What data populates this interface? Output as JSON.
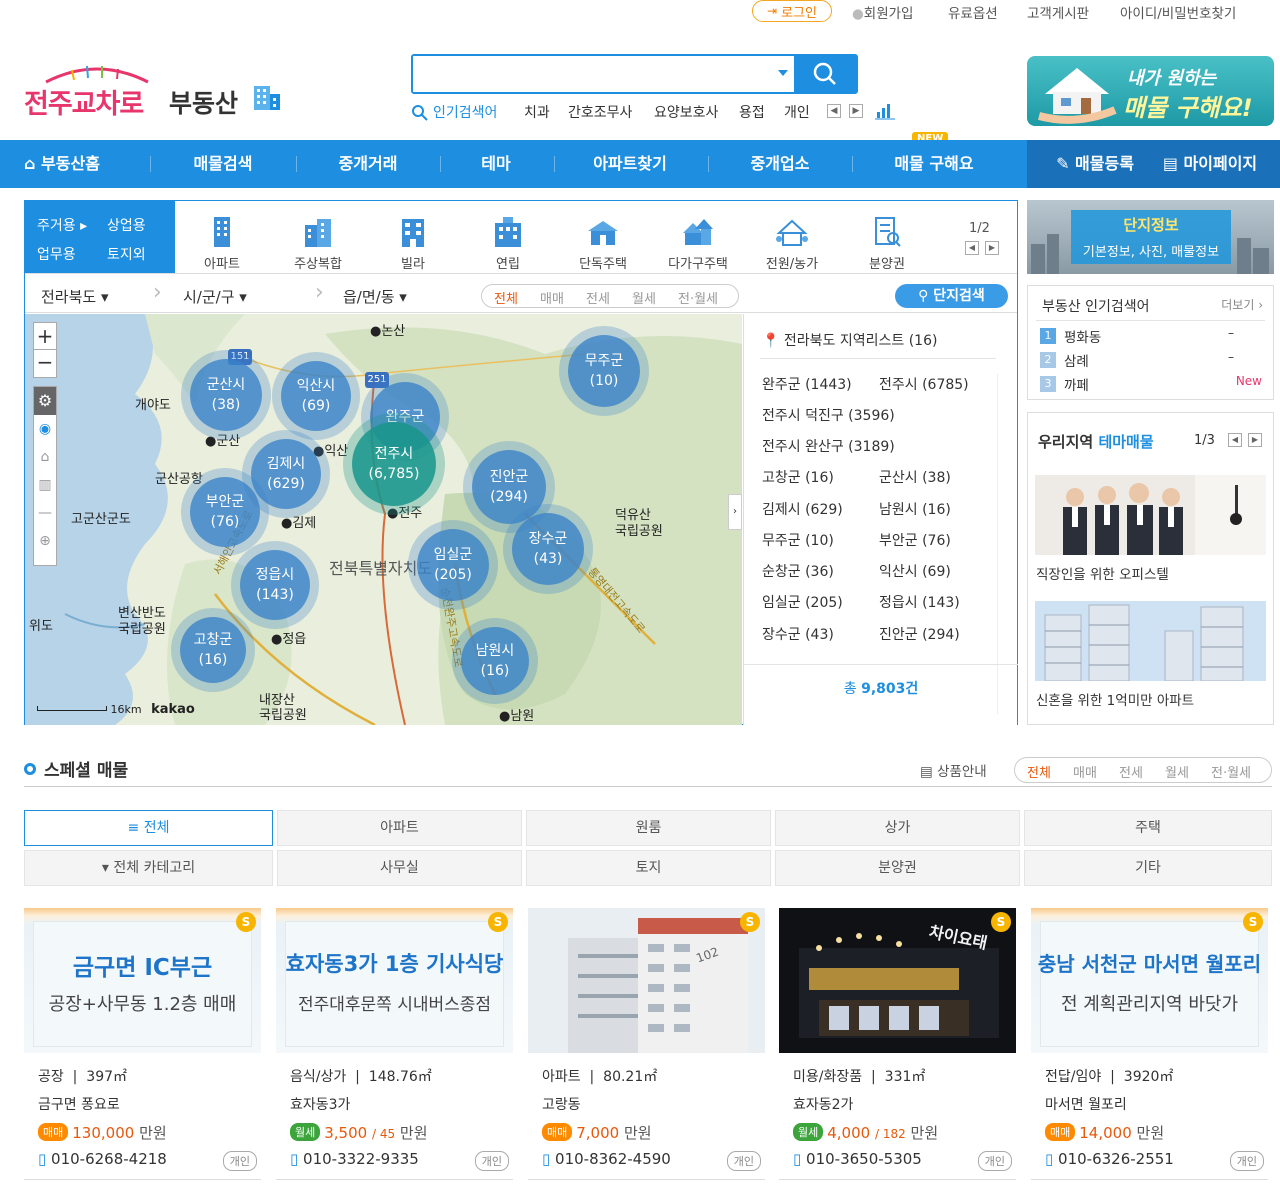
{
  "top_links": {
    "login": "로그인",
    "signup": "회원가입",
    "paid_options": "유료옵션",
    "customer_board": "고객게시판",
    "find_account": "아이디/비밀번호찾기"
  },
  "logo": {
    "main": "전주교차로",
    "sub": "부동산"
  },
  "search": {
    "value": "",
    "placeholder": ""
  },
  "popular_search": {
    "label": "인기검색어",
    "keywords": [
      "치과",
      "간호조무사",
      "요양보호사",
      "용접",
      "개인"
    ]
  },
  "top_banner": {
    "line1": "내가 원하는",
    "line2": "매물 구해요!"
  },
  "nav": {
    "items": [
      "부동산홈",
      "매물검색",
      "중개거래",
      "테마",
      "아파트찾기",
      "중개업소",
      "매물 구해요"
    ],
    "new_badge": "NEW",
    "register": "매물등록",
    "mypage": "마이페이지"
  },
  "usage": [
    "주거용",
    "상업용",
    "업무용",
    "토지외"
  ],
  "property_types": [
    "아파트",
    "주상복합",
    "빌라",
    "연립",
    "단독주택",
    "다가구주택",
    "전원/농가",
    "분양권"
  ],
  "property_page": "1/2",
  "region": {
    "province": "전라북도",
    "city": "시/군/구",
    "town": "읍/면/동"
  },
  "deal_tabs": [
    "전체",
    "매매",
    "전세",
    "월세",
    "전·월세"
  ],
  "complex_search": "단지검색",
  "map": {
    "clusters": [
      {
        "name": "군산시",
        "count": "(38)"
      },
      {
        "name": "익산시",
        "count": "(69)"
      },
      {
        "name": "완주군",
        "count": ""
      },
      {
        "name": "무주군",
        "count": "(10)"
      },
      {
        "name": "전주시",
        "count": "(6,785)"
      },
      {
        "name": "김제시",
        "count": "(629)"
      },
      {
        "name": "진안군",
        "count": "(294)"
      },
      {
        "name": "부안군",
        "count": "(76)"
      },
      {
        "name": "장수군",
        "count": "(43)"
      },
      {
        "name": "임실군",
        "count": "(205)"
      },
      {
        "name": "정읍시",
        "count": "(143)"
      },
      {
        "name": "고창군",
        "count": "(16)"
      },
      {
        "name": "남원시",
        "count": "(16)"
      }
    ],
    "places": [
      "●논산",
      "개야도",
      "●군산",
      "●익산",
      "군산공항",
      "고군산군도",
      "●김제",
      "●전주",
      "덕유산\n국립공원",
      "전북특별자치도",
      "변산반도\n국립공원",
      "위도",
      "●정읍",
      "내장산\n국립공원",
      "●남원"
    ],
    "highway_labels": [
      "151",
      "251"
    ],
    "road_labels": [
      "서해안고속도로",
      "통영대전고속도로",
      "순천완주고속도로"
    ],
    "scale": "16km",
    "provider": "kakao"
  },
  "region_list": {
    "title": "전라북도 지역리스트 (16)",
    "rows": [
      [
        "완주군 (1443)",
        "전주시 (6785)"
      ],
      [
        "전주시 덕진구 (3596)",
        ""
      ],
      [
        "전주시 완산구 (3189)",
        ""
      ],
      [
        "고창군 (16)",
        "군산시 (38)"
      ],
      [
        "김제시 (629)",
        "남원시 (16)"
      ],
      [
        "무주군 (10)",
        "부안군 (76)"
      ],
      [
        "순창군 (36)",
        "익산시 (69)"
      ],
      [
        "임실군 (205)",
        "정읍시 (143)"
      ],
      [
        "장수군 (43)",
        "진안군 (294)"
      ]
    ],
    "total_label": "총",
    "total": "9,803건"
  },
  "complex_info": {
    "title": "단지정보",
    "subtitle": "기본정보, 사진, 매물정보"
  },
  "popular_realestate": {
    "title": "부동산 인기검색어",
    "more": "더보기 ›",
    "items": [
      {
        "rank": "1",
        "name": "평화동",
        "change": "–"
      },
      {
        "rank": "2",
        "name": "삼례",
        "change": "–"
      },
      {
        "rank": "3",
        "name": "까페",
        "change": "New"
      }
    ]
  },
  "theme": {
    "title_a": "우리지역",
    "title_b": "테마매물",
    "page": "1/3",
    "items": [
      "직장인을 위한 오피스텔",
      "신혼을 위한 1억미만 아파트"
    ]
  },
  "special": {
    "title": "스페셜 매물",
    "guide": "상품안내",
    "deal_tabs": [
      "전체",
      "매매",
      "전세",
      "월세",
      "전·월세"
    ],
    "categories_row1": [
      "≡ 전체",
      "아파트",
      "원룸",
      "상가",
      "주택"
    ],
    "categories_row2": [
      "▾ 전체 카테고리",
      "사무실",
      "토지",
      "분양권",
      "기타"
    ]
  },
  "cards": [
    {
      "img_title": "금구면 IC부근",
      "img_sub": "공장+사무동 1.2층 매매",
      "type": "공장",
      "area": "397㎡",
      "address": "금구면 퐁요로",
      "deal": "매매",
      "price": "130,000",
      "monthly": "",
      "unit": "만원",
      "tel": "010-6268-4218",
      "owner": "개인"
    },
    {
      "img_title": "효자동3가 1층 기사식당",
      "img_sub": "전주대후문쪽 시내버스종점",
      "type": "음식/상가",
      "area": "148.76㎡",
      "address": "효자동3가",
      "deal": "월세",
      "price": "3,500",
      "monthly": "/ 45",
      "unit": "만원",
      "tel": "010-3322-9335",
      "owner": "개인"
    },
    {
      "img_title": "",
      "img_sub": "",
      "type": "아파트",
      "area": "80.21㎡",
      "address": "고랑동",
      "deal": "매매",
      "price": "7,000",
      "monthly": "",
      "unit": "만원",
      "tel": "010-8362-4590",
      "owner": "개인",
      "building_no": "102"
    },
    {
      "img_title": "",
      "img_sub": "",
      "type": "미용/화장품",
      "area": "331㎡",
      "address": "효자동2가",
      "deal": "월세",
      "price": "4,000",
      "monthly": "/ 182",
      "unit": "만원",
      "tel": "010-3650-5305",
      "owner": "개인",
      "sign": "차이요태"
    },
    {
      "img_title": "충남 서천군 마서면 월포리",
      "img_sub": "전 계획관리지역 바닷가",
      "type": "전답/임야",
      "area": "3920㎡",
      "address": "마서면 월포리",
      "deal": "매매",
      "price": "14,000",
      "monthly": "",
      "unit": "만원",
      "tel": "010-6326-2551",
      "owner": "개인"
    }
  ],
  "colors": {
    "primary": "#1e8ee0",
    "nav_dark": "#1a71b9",
    "logo_pink": "#e8366c",
    "sale_badge": "#ff8a00",
    "rent_badge": "#3ba53b",
    "price_orange": "#e8580c",
    "cluster": "#3a82c8"
  }
}
